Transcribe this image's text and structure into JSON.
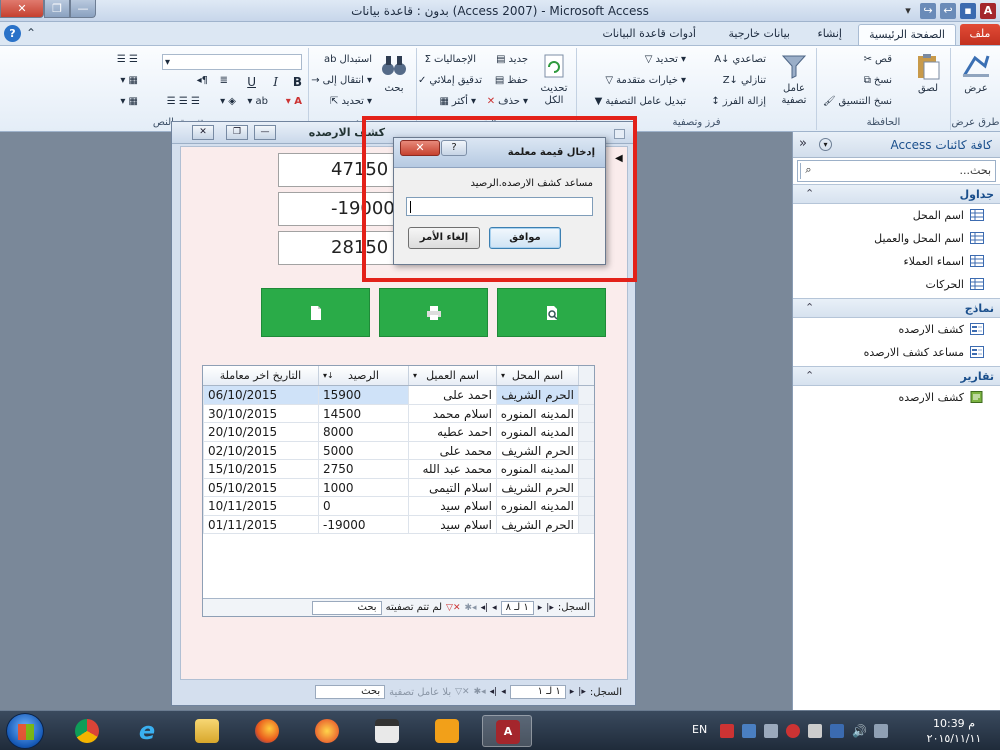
{
  "window": {
    "title": "بدون : قاعدة بيانات (Access 2007) - Microsoft Access"
  },
  "tabs": [
    "ملف",
    "الصفحة الرئيسية",
    "إنشاء",
    "بيانات خارجية",
    "أدوات قاعدة البيانات"
  ],
  "ribbon": {
    "views": {
      "view": "عرض",
      "group": "طرق عرض"
    },
    "clipboard": {
      "paste": "لصق",
      "cut": "قص",
      "copy": "نسخ",
      "format_painter": "نسخ التنسيق",
      "group": "الحافظة"
    },
    "sort_filter": {
      "filter": "عامل تصفية",
      "ascending": "تصاعدي",
      "descending": "تنازلي",
      "remove_sort": "إزالة الفرز",
      "selection": "تحديد",
      "advanced": "خيارات متقدمة",
      "toggle_filter": "تبديل عامل التصفية",
      "group": "فرز وتصفية"
    },
    "records": {
      "refresh": "تحديث الكل",
      "new": "جديد",
      "save": "حفظ",
      "delete": "حذف",
      "totals": "الإجماليات",
      "spelling": "تدقيق إملائي",
      "more": "أكثر",
      "group": "سجلات"
    },
    "find": {
      "find": "بحث",
      "replace": "استبدال",
      "goto": "انتقال إلى",
      "select": "تحديد",
      "group": "بحث"
    },
    "text_format": {
      "bold": "B",
      "italic": "I",
      "underline": "U",
      "group": "تنسيق النص"
    }
  },
  "nav": {
    "title": "كافة كائنات Access",
    "search_placeholder": "بحث...",
    "groups": [
      {
        "name": "جداول",
        "items": [
          "اسم المحل",
          "اسم المحل والعميل",
          "اسماء العملاء",
          "الحركات"
        ]
      },
      {
        "name": "نماذج",
        "items": [
          "كشف الارصده",
          "مساعد كشف الارصده"
        ]
      },
      {
        "name": "تقارير",
        "items": [
          "كشف الارصده"
        ]
      }
    ]
  },
  "form": {
    "title": "كشف الارصده",
    "totals": [
      "47150",
      "-19000",
      "28150"
    ],
    "columns": [
      "اسم المحل",
      "اسم العميل",
      "الرصيد",
      "التاريخ اخر معاملة"
    ],
    "rows": [
      {
        "shop": "الحرم الشريف",
        "client": "احمد على",
        "balance": "15900",
        "date": "06/10/2015"
      },
      {
        "shop": "المدينه المنوره",
        "client": "اسلام محمد",
        "balance": "14500",
        "date": "30/10/2015"
      },
      {
        "shop": "المدينه المنوره",
        "client": "احمد عطيه",
        "balance": "8000",
        "date": "20/10/2015"
      },
      {
        "shop": "الحرم الشريف",
        "client": "محمد على",
        "balance": "5000",
        "date": "02/10/2015"
      },
      {
        "shop": "المدينه المنوره",
        "client": "محمد عبد الله",
        "balance": "2750",
        "date": "15/10/2015"
      },
      {
        "shop": "الحرم الشريف",
        "client": "اسلام التيمى",
        "balance": "1000",
        "date": "05/10/2015"
      },
      {
        "shop": "المدينه المنوره",
        "client": "اسلام سيد",
        "balance": "0",
        "date": "10/11/2015"
      },
      {
        "shop": "الحرم الشريف",
        "client": "اسلام سيد",
        "balance": "-19000",
        "date": "01/11/2015"
      }
    ],
    "sub_nav": {
      "label": "السجل:",
      "position": "١ لـ ٨",
      "filter": "لم تتم تصفيته",
      "search": "بحث"
    },
    "main_nav": {
      "label": "السجل:",
      "position": "١ لـ ١",
      "filter": "بلا عامل تصفية",
      "search": "بحث"
    }
  },
  "dialog": {
    "title": "إدخال قيمة معلمة",
    "prompt": "مساعد كشف الارصده.الرصيد",
    "value": "",
    "ok": "موافق",
    "cancel": "إلغاء الأمر"
  },
  "taskbar": {
    "lang": "EN",
    "time": "10:39 م",
    "date": "٢٠١٥/١١/١١"
  },
  "colors": {
    "accent": "#2aab48",
    "highlight": "#e32119",
    "file_tab": "#c23120"
  }
}
